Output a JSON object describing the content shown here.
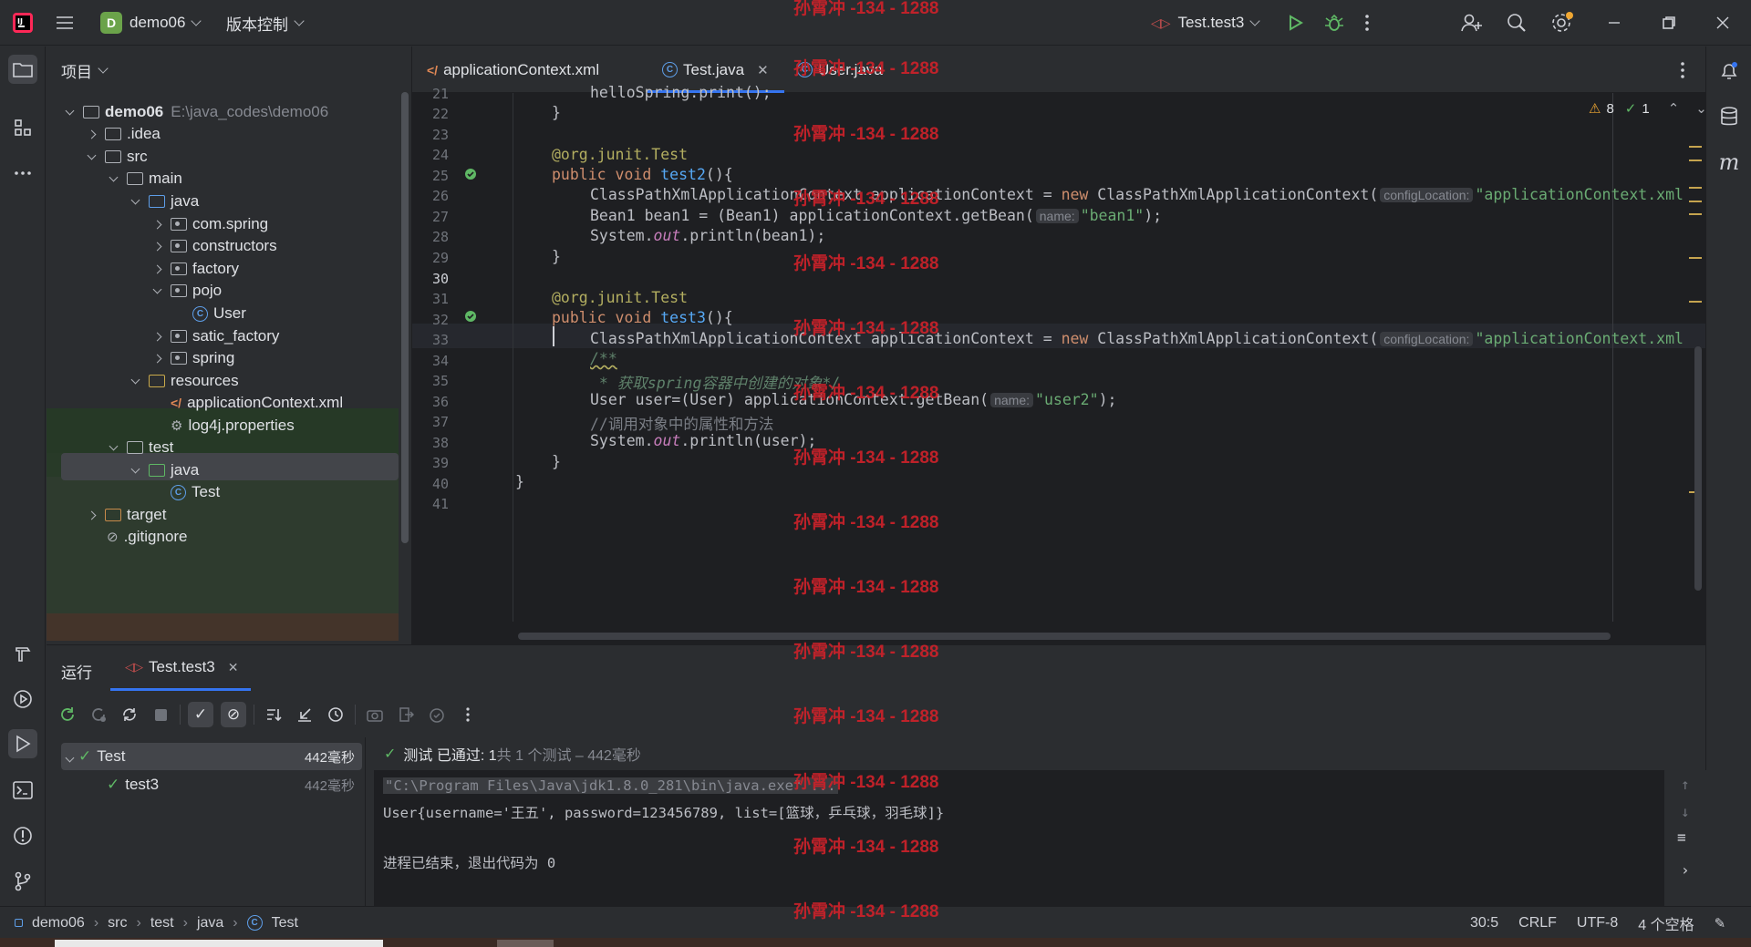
{
  "titlebar": {
    "project_letter": "D",
    "project_name": "demo06",
    "vcs_label": "版本控制",
    "run_config": "Test.test3"
  },
  "project_panel": {
    "title": "项目",
    "tree": [
      {
        "label": "demo06",
        "path": "E:\\java_codes\\demo06"
      },
      {
        "label": ".idea"
      },
      {
        "label": "src"
      },
      {
        "label": "main"
      },
      {
        "label": "java"
      },
      {
        "label": "com.spring"
      },
      {
        "label": "constructors"
      },
      {
        "label": "factory"
      },
      {
        "label": "pojo"
      },
      {
        "label": "User"
      },
      {
        "label": "satic_factory"
      },
      {
        "label": "spring"
      },
      {
        "label": "resources"
      },
      {
        "label": "applicationContext.xml"
      },
      {
        "label": "log4j.properties"
      },
      {
        "label": "test"
      },
      {
        "label": "java"
      },
      {
        "label": "Test"
      },
      {
        "label": "target"
      },
      {
        "label": ".gitignore"
      }
    ]
  },
  "tabs": [
    {
      "label": "applicationContext.xml"
    },
    {
      "label": "Test.java"
    },
    {
      "label": "User.java"
    }
  ],
  "editor": {
    "warnings": "8",
    "checks": "1",
    "line_numbers": [
      "21",
      "22",
      "23",
      "24",
      "25",
      "26",
      "27",
      "28",
      "29",
      "30",
      "31",
      "32",
      "33",
      "34",
      "35",
      "36",
      "37",
      "38",
      "39",
      "40",
      "41"
    ],
    "code": {
      "l21": "helloSpring.print();",
      "brace": "}",
      "annotation": "@org.junit.Test",
      "public_void": "public void ",
      "test2": "test2",
      "test3": "test3",
      "parens": "(){",
      "cpx": "ClassPathXmlApplicationContext applicationContext = ",
      "new_kw": "new",
      "cpx_ctor": " ClassPathXmlApplicationContext(",
      "hint_config": "configLocation:",
      "str_appctx": "\"applicationContext.xml",
      "l27a": "Bean1 bean1 = (Bean1) applicationContext.getBean(",
      "hint_name": "name:",
      "str_bean1": "\"bean1\"",
      "close_stmt": ");",
      "sysout_a": "System.",
      "out": "out",
      "l28b": ".println(bean1);",
      "l34": "/**",
      "l35": " * 获取spring容器中创建的对象*/",
      "l36a": "User user=(User) applicationContext.getBean(",
      "str_user2": "\"user2\"",
      "l37": "//调用对象中的属性和方法",
      "l38b": ".println(user);"
    }
  },
  "run_panel": {
    "title": "运行",
    "tab_label": "Test.test3",
    "status_text": "测试 已通过: 1",
    "status_sub": "共 1 个测试 – 442毫秒",
    "tree": [
      {
        "label": "Test",
        "time": "442毫秒"
      },
      {
        "label": "test3",
        "time": "442毫秒"
      }
    ],
    "console": [
      "\"C:\\Program Files\\Java\\jdk1.8.0_281\\bin\\java.exe\" ...",
      "User{username='王五', password=123456789, list=[篮球，乒乓球，羽毛球]}",
      "",
      "进程已结束，退出代码为 0"
    ]
  },
  "statusbar": {
    "breadcrumb": [
      "demo06",
      "src",
      "test",
      "java",
      "Test"
    ],
    "position": "30:5",
    "line_sep": "CRLF",
    "encoding": "UTF-8",
    "indent": "4 个空格"
  },
  "watermark": "孙霄冲 -134 - 1288",
  "colors": {
    "bg": "#2b2d30",
    "editor_bg": "#1e1f22",
    "accent": "#3574f0",
    "keyword": "#cf8e6d",
    "string": "#6aab73",
    "pass_green": "#5fb865",
    "watermark": "#c7222a"
  }
}
